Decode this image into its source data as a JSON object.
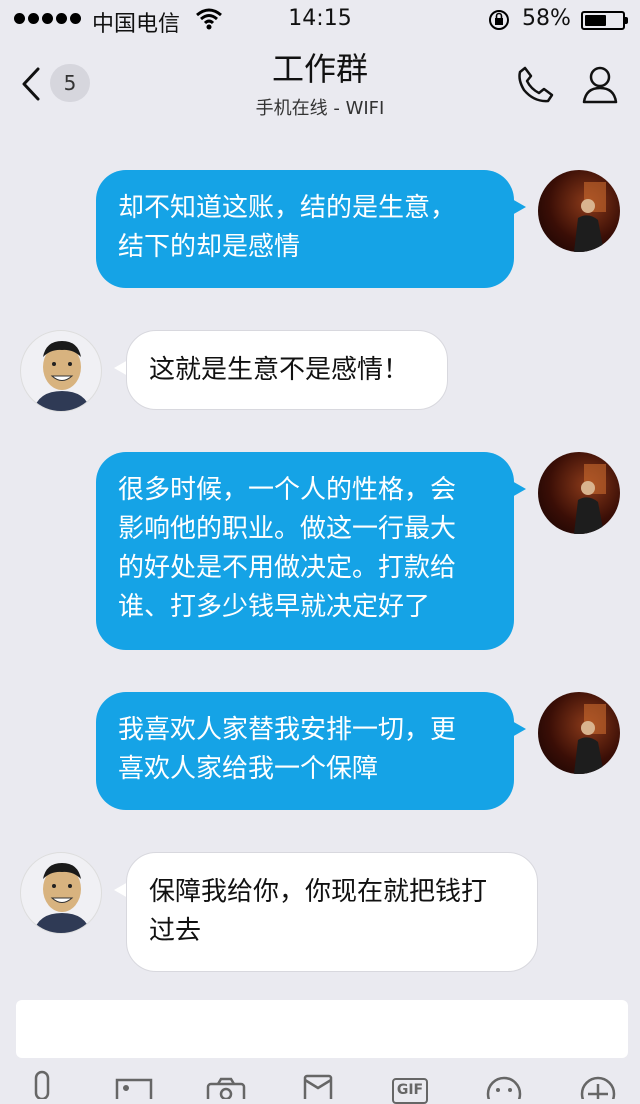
{
  "status_bar": {
    "carrier": "中国电信",
    "time": "14:15",
    "battery_percent": "58%",
    "battery_level": 0.58,
    "icons": [
      "signal-dots-icon",
      "wifi-icon",
      "rotation-lock-icon",
      "battery-icon"
    ]
  },
  "nav": {
    "back_icon": "chevron-left-icon",
    "unread_count": "5",
    "title": "工作群",
    "subtitle": "手机在线 - WIFI",
    "actions": [
      "phone-icon",
      "user-profile-icon"
    ]
  },
  "messages": [
    {
      "side": "right",
      "text_lines": [
        "却不知道这账，结的是生意，",
        "结下的却是感情"
      ]
    },
    {
      "side": "left",
      "text_lines": [
        "这就是生意不是感情！"
      ]
    },
    {
      "side": "right",
      "text_lines": [
        "很多时候，一个人的性格，会",
        "影响他的职业。做这一行最大",
        "的好处是不用做决定。打款给",
        "谁、打多少钱早就决定好了"
      ]
    },
    {
      "side": "right",
      "text_lines": [
        "我喜欢人家替我安排一切，更",
        "喜欢人家给我一个保障"
      ]
    },
    {
      "side": "left",
      "text_lines": [
        "保障我给你，你现在就把钱打",
        "过去"
      ]
    }
  ],
  "input": {
    "placeholder": ""
  },
  "toolbar": {
    "items": [
      "microphone-icon",
      "image-icon",
      "camera-icon",
      "red-packet-icon",
      "gif-icon",
      "emoji-icon",
      "plus-icon"
    ],
    "gif_label": "GIF"
  },
  "colors": {
    "outgoing_bubble": "#15a3e6",
    "incoming_bubble": "#ffffff",
    "background": "#eaeaf0"
  }
}
